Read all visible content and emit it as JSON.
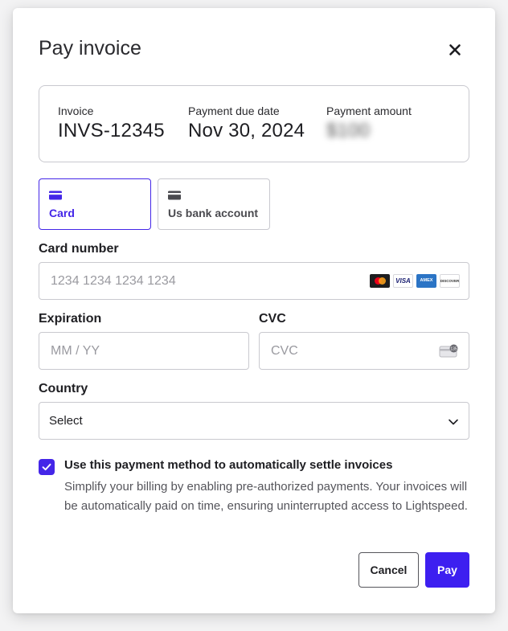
{
  "modal": {
    "title": "Pay invoice",
    "close_icon": "close-icon"
  },
  "summary": {
    "invoice_label": "Invoice",
    "invoice_value": "INVS-12345",
    "due_label": "Payment due date",
    "due_value": "Nov 30, 2024",
    "amount_label": "Payment amount",
    "amount_value": "$100"
  },
  "methods": [
    {
      "label": "Card",
      "icon": "credit-card-icon",
      "selected": true
    },
    {
      "label": "Us bank account",
      "icon": "bank-card-icon",
      "selected": false
    }
  ],
  "card_number": {
    "label": "Card number",
    "placeholder": "1234 1234 1234 1234",
    "brands": [
      "mastercard",
      "VISA",
      "AMEX",
      "DISCOVER"
    ]
  },
  "expiration": {
    "label": "Expiration",
    "placeholder": "MM / YY"
  },
  "cvc": {
    "label": "CVC",
    "placeholder": "CVC",
    "icon_text": "135"
  },
  "country": {
    "label": "Country",
    "selected": "Select"
  },
  "consent": {
    "checked": true,
    "title": "Use this payment method to automatically settle invoices",
    "body": "Simplify your billing by enabling pre-authorized payments. Your invoices will be automatically paid on time, ensuring uninterrupted access to Lightspeed."
  },
  "actions": {
    "cancel_label": "Cancel",
    "pay_label": "Pay"
  },
  "colors": {
    "accent": "#4426e8",
    "pay_button": "#3d1ff0",
    "border": "#c9c9cf"
  }
}
